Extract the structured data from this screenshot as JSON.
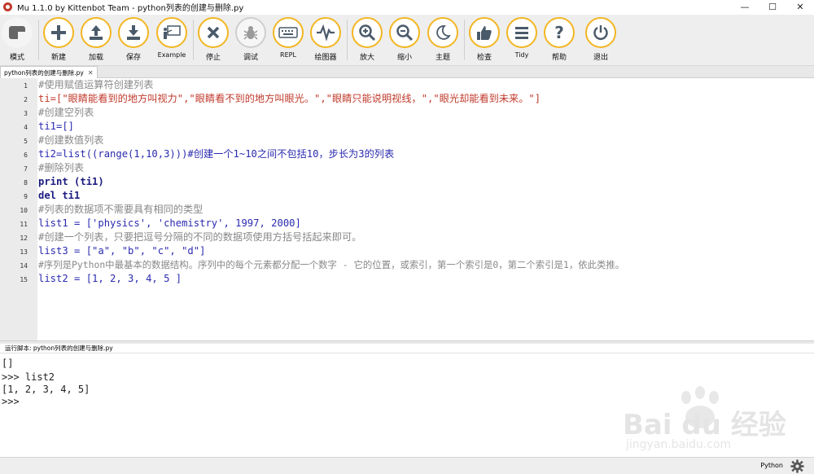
{
  "window": {
    "title": "Mu 1.1.0 by Kittenbot Team - python列表的创建与删除.py",
    "controls": {
      "minimize": "—",
      "maximize": "☐",
      "close": "✕"
    }
  },
  "toolbar": {
    "items": [
      {
        "label": "模式",
        "icon": "mode-icon"
      },
      {
        "label": "新建",
        "icon": "plus-icon"
      },
      {
        "label": "加载",
        "icon": "upload-icon"
      },
      {
        "label": "保存",
        "icon": "download-icon"
      },
      {
        "label": "Example",
        "icon": "presentation-icon"
      },
      {
        "label": "停止",
        "icon": "close-icon"
      },
      {
        "label": "调试",
        "icon": "bug-icon"
      },
      {
        "label": "REPL",
        "icon": "keyboard-icon"
      },
      {
        "label": "绘图器",
        "icon": "pulse-icon"
      },
      {
        "label": "放大",
        "icon": "zoom-in-icon"
      },
      {
        "label": "缩小",
        "icon": "zoom-out-icon"
      },
      {
        "label": "主题",
        "icon": "moon-icon"
      },
      {
        "label": "检查",
        "icon": "thumbs-up-icon"
      },
      {
        "label": "Tidy",
        "icon": "menu-lines-icon"
      },
      {
        "label": "帮助",
        "icon": "question-icon"
      },
      {
        "label": "退出",
        "icon": "power-icon"
      }
    ],
    "accent_color": "#f3b623"
  },
  "tab": {
    "label": "python列表的创建与删除.py",
    "close": "✕"
  },
  "editor": {
    "line_numbers": [
      "1",
      "2",
      "3",
      "4",
      "5",
      "6",
      "7",
      "8",
      "9",
      "10",
      "11",
      "12",
      "13",
      "14",
      "15"
    ],
    "lines": [
      "#使用赋值运算符创建列表",
      "ti=[\"眼睛能看到的地方叫视力\",\"眼睛看不到的地方叫眼光。\",\"眼睛只能说明视线，\",\"眼光却能看到未来。\"]",
      "#创建空列表",
      "ti1=[]",
      "#创建数值列表",
      "ti2=list((range(1,10,3)))#创建一个1~10之间不包括10，步长为3的列表",
      "#删除列表",
      "print (ti1)",
      "del ti1",
      "#列表的数据项不需要具有相同的类型",
      "list1 = ['physics', 'chemistry', 1997, 2000]",
      "#创建一个列表，只要把逗号分隔的不同的数据项使用方括号括起来即可。",
      "list3 = [\"a\", \"b\", \"c\", \"d\"]",
      "#序列是Python中最基本的数据结构。序列中的每个元素都分配一个数字 - 它的位置，或索引，第一个索引是0，第二个索引是1，依此类推。",
      "list2 = [1, 2, 3, 4, 5 ]"
    ]
  },
  "repl": {
    "header": "运行脚本: python列表的创建与删除.py",
    "lines": [
      "[]",
      ">>> list2",
      "[1, 2, 3, 4, 5]",
      ">>>"
    ]
  },
  "status": {
    "mode": "Python",
    "settings_icon": "gear-icon"
  },
  "watermark": {
    "brand": "Bai du 经验",
    "url": "jingyan.baidu.com"
  }
}
